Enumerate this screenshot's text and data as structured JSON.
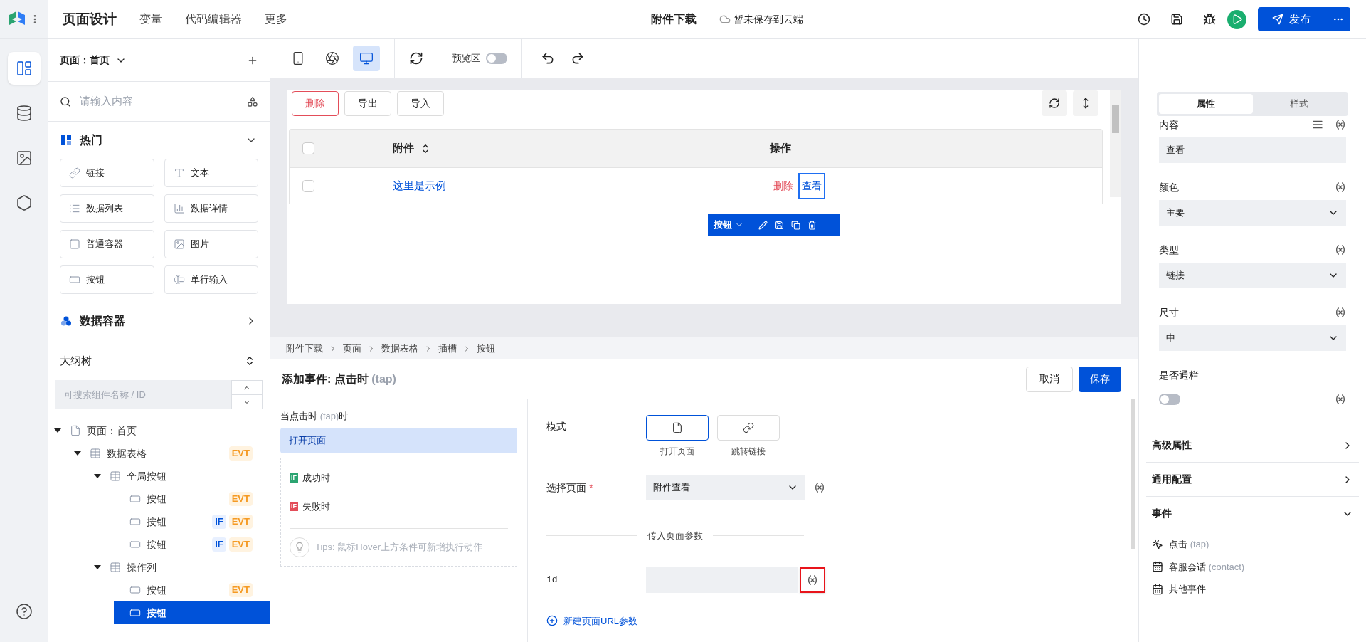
{
  "app_bar": {
    "title": "页面设计",
    "menu": [
      {
        "label": "变量"
      },
      {
        "label": "代码编辑器"
      },
      {
        "label": "更多"
      }
    ],
    "document_title": "附件下载",
    "save_status": "暂未保存到云端",
    "publish": "发布"
  },
  "rail": [
    {
      "kind": "layout",
      "selected": true
    },
    {
      "kind": "database",
      "selected": false
    },
    {
      "kind": "image",
      "selected": false
    },
    {
      "kind": "component",
      "selected": false
    },
    {
      "kind": "help",
      "selected": false
    }
  ],
  "left_panel": {
    "page_selector": "页面：首页",
    "search": {
      "placeholder": "请输入内容"
    },
    "sections": [
      {
        "title": "热门",
        "kind": "hot",
        "expanded": true,
        "items": [
          {
            "label": "链接",
            "kind": "link"
          },
          {
            "label": "文本",
            "kind": "text"
          },
          {
            "label": "数据列表",
            "kind": "list"
          },
          {
            "label": "数据详情",
            "kind": "detail"
          },
          {
            "label": "普通容器",
            "kind": "container"
          },
          {
            "label": "图片",
            "kind": "image"
          },
          {
            "label": "按钮",
            "kind": "button"
          },
          {
            "label": "单行输入",
            "kind": "input"
          }
        ]
      },
      {
        "title": "数据容器",
        "kind": "data",
        "expanded": false
      }
    ],
    "outline": {
      "title": "大纲树",
      "search": {
        "placeholder": "可搜索组件名称 / ID"
      },
      "tree": [
        {
          "label": "页面：首页",
          "kind": "page",
          "expanded": true,
          "selected": false,
          "children": [
            {
              "label": "数据表格",
              "kind": "table",
              "expanded": true,
              "selected": false,
              "badges": [
                {
                  "text": "EVT",
                  "kind": "evt"
                }
              ],
              "children": [
                {
                  "label": "全局按钮",
                  "kind": "table",
                  "expanded": true,
                  "selected": false,
                  "children": [
                    {
                      "label": "按钮",
                      "kind": "button",
                      "selected": false,
                      "badges": [
                        {
                          "text": "EVT",
                          "kind": "evt"
                        }
                      ]
                    },
                    {
                      "label": "按钮",
                      "kind": "button",
                      "selected": false,
                      "badges": [
                        {
                          "text": "IF",
                          "kind": "if"
                        },
                        {
                          "text": "EVT",
                          "kind": "evt"
                        }
                      ]
                    },
                    {
                      "label": "按钮",
                      "kind": "button",
                      "selected": false,
                      "badges": [
                        {
                          "text": "IF",
                          "kind": "if"
                        },
                        {
                          "text": "EVT",
                          "kind": "evt"
                        }
                      ]
                    }
                  ]
                },
                {
                  "label": "操作列",
                  "kind": "table",
                  "expanded": true,
                  "selected": false,
                  "children": [
                    {
                      "label": "按钮",
                      "kind": "button",
                      "selected": false,
                      "badges": [
                        {
                          "text": "EVT",
                          "kind": "evt"
                        }
                      ]
                    },
                    {
                      "label": "按钮",
                      "kind": "button",
                      "selected": true
                    }
                  ]
                }
              ]
            }
          ]
        }
      ]
    }
  },
  "toolbar": {
    "devices": [
      {
        "kind": "mobile",
        "selected": false
      },
      {
        "kind": "miniprogram",
        "selected": false
      },
      {
        "kind": "desktop",
        "selected": true
      }
    ],
    "preview": {
      "label": "预览区",
      "on": false
    }
  },
  "canvas": {
    "buttons": [
      {
        "label": "删除",
        "kind": "danger"
      },
      {
        "label": "导出",
        "kind": "default"
      },
      {
        "label": "导入",
        "kind": "default"
      }
    ],
    "table": {
      "select_all": {
        "checked": false
      },
      "columns": [
        {
          "label": "附件",
          "sortable": true
        },
        {
          "label": "操作"
        }
      ],
      "rows": [
        {
          "checked": false,
          "cell": "这里是示例",
          "actions": [
            {
              "label": "删除",
              "kind": "danger",
              "selected": false
            },
            {
              "label": "查看",
              "kind": "link",
              "selected": true
            }
          ]
        }
      ]
    },
    "selection_toolbar": {
      "label": "按钮"
    }
  },
  "breadcrumb": [
    "附件下载",
    "页面",
    "数据表格",
    "插槽",
    "按钮"
  ],
  "event_editor": {
    "title": "添加事件: 点击时",
    "title_hint": "(tap)",
    "cancel": "取消",
    "save": "保存",
    "trigger": {
      "prefix": "当点击时",
      "hint": "(tap)",
      "suffix": "时"
    },
    "actions": [
      {
        "label": "打开页面",
        "selected": true
      }
    ],
    "conditions": [
      {
        "badge": "IF",
        "label": "成功时",
        "color": "#2ba471"
      },
      {
        "badge": "IF",
        "label": "失败时",
        "color": "#e34d59"
      }
    ],
    "tips": "Tips: 鼠标Hover上方条件可新增执行动作",
    "mode": {
      "label": "模式",
      "options": [
        {
          "label": "打开页面",
          "kind": "page",
          "selected": true
        },
        {
          "label": "跳转链接",
          "kind": "link",
          "selected": false
        }
      ]
    },
    "page_select": {
      "label": "选择页面",
      "required_mark": "*",
      "value": "附件查看"
    },
    "params_divider": "传入页面参数",
    "params": [
      {
        "name": "id",
        "highlighted": true
      }
    ],
    "add_param": "新建页面URL参数"
  },
  "right_panel": {
    "tabs": [
      {
        "label": "属性",
        "selected": true
      },
      {
        "label": "样式",
        "selected": false
      }
    ],
    "fields": [
      {
        "label": "内容",
        "kind": "input",
        "value": "查看"
      },
      {
        "label": "颜色",
        "kind": "select",
        "value": "主要"
      },
      {
        "label": "类型",
        "kind": "select",
        "value": "链接"
      },
      {
        "label": "尺寸",
        "kind": "select",
        "value": "中"
      },
      {
        "label": "是否通栏",
        "kind": "switch",
        "on": false
      }
    ],
    "sections": [
      {
        "title": "高级属性",
        "expanded": false
      },
      {
        "title": "通用配置",
        "expanded": false
      },
      {
        "title": "事件",
        "expanded": true
      }
    ],
    "events": [
      {
        "label": "点击",
        "hint": "(tap)",
        "kind": "tap"
      },
      {
        "label": "客服会话",
        "hint": "(contact)",
        "kind": "calendar"
      },
      {
        "label": "其他事件",
        "kind": "calendar"
      }
    ]
  }
}
